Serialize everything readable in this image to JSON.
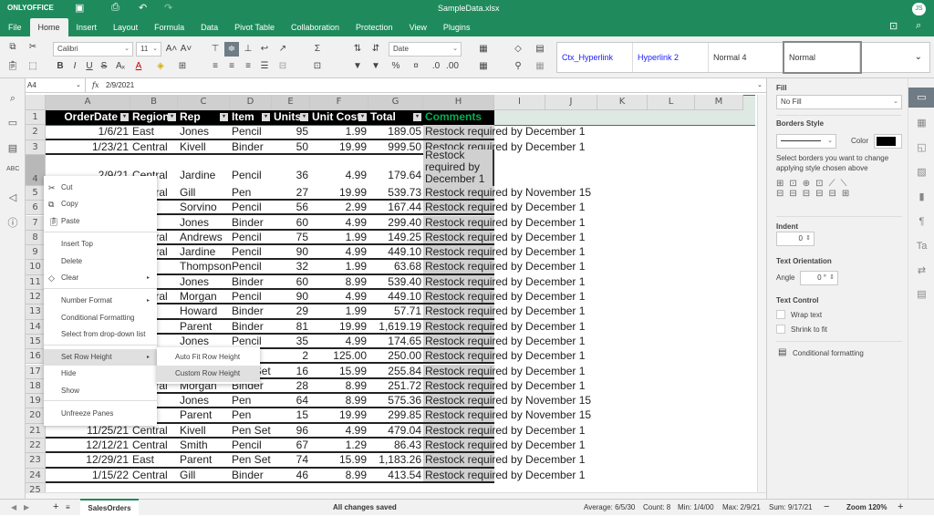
{
  "app": {
    "brand": "ONLYOFFICE",
    "file_title": "SampleData.xlsx",
    "user_initials": "JS"
  },
  "menu_tabs": [
    "File",
    "Home",
    "Insert",
    "Layout",
    "Formula",
    "Data",
    "Pivot Table",
    "Collaboration",
    "Protection",
    "View",
    "Plugins"
  ],
  "toolbar": {
    "font_name": "Calibri",
    "font_size": "11",
    "number_format": "Date",
    "styles": [
      "Ctx_Hyperlink",
      "Hyperlink 2",
      "Normal 4",
      "Normal"
    ]
  },
  "formula_bar": {
    "cell_ref": "A4",
    "fx": "fx",
    "value": "2/9/2021"
  },
  "columns": [
    "A",
    "B",
    "C",
    "D",
    "E",
    "F",
    "G",
    "H",
    "I",
    "J",
    "K",
    "L",
    "M"
  ],
  "header_row": [
    "OrderDate",
    "Region",
    "Rep",
    "Item",
    "Units",
    "Unit Cost",
    "Total",
    "Comments"
  ],
  "rows": [
    {
      "n": "2",
      "c": [
        "1/6/21",
        "East",
        "Jones",
        "Pencil",
        "95",
        "1.99",
        "189.05",
        "Restock required by December 1"
      ]
    },
    {
      "n": "3",
      "c": [
        "1/23/21",
        "Central",
        "Kivell",
        "Binder",
        "50",
        "19.99",
        "999.50",
        "Restock required by December 1"
      ]
    },
    {
      "n": "4",
      "c": [
        "2/9/21",
        "Central",
        "Jardine",
        "Pencil",
        "36",
        "4.99",
        "179.64",
        "Restock required by December 1"
      ]
    },
    {
      "n": "5",
      "c": [
        "",
        "Central",
        "Gill",
        "Pen",
        "27",
        "19.99",
        "539.73",
        "Restock required by November 15"
      ]
    },
    {
      "n": "6",
      "c": [
        "",
        "",
        "Sorvino",
        "Pencil",
        "56",
        "2.99",
        "167.44",
        "Restock required by December 1"
      ]
    },
    {
      "n": "7",
      "c": [
        "",
        "",
        "Jones",
        "Binder",
        "60",
        "4.99",
        "299.40",
        "Restock required by December 1"
      ]
    },
    {
      "n": "8",
      "c": [
        "",
        "Central",
        "Andrews",
        "Pencil",
        "75",
        "1.99",
        "149.25",
        "Restock required by December 1"
      ]
    },
    {
      "n": "9",
      "c": [
        "",
        "Central",
        "Jardine",
        "Pencil",
        "90",
        "4.99",
        "449.10",
        "Restock required by December 1"
      ]
    },
    {
      "n": "10",
      "c": [
        "",
        "",
        "Thompson",
        "Pencil",
        "32",
        "1.99",
        "63.68",
        "Restock required by December 1"
      ]
    },
    {
      "n": "11",
      "c": [
        "",
        "",
        "Jones",
        "Binder",
        "60",
        "8.99",
        "539.40",
        "Restock required by December 1"
      ]
    },
    {
      "n": "12",
      "c": [
        "",
        "Central",
        "Morgan",
        "Pencil",
        "90",
        "4.99",
        "449.10",
        "Restock required by December 1"
      ]
    },
    {
      "n": "13",
      "c": [
        "",
        "",
        "Howard",
        "Binder",
        "29",
        "1.99",
        "57.71",
        "Restock required by December 1"
      ]
    },
    {
      "n": "14",
      "c": [
        "",
        "",
        "Parent",
        "Binder",
        "81",
        "19.99",
        "1,619.19",
        "Restock required by December 1"
      ]
    },
    {
      "n": "15",
      "c": [
        "",
        "",
        "Jones",
        "Pencil",
        "35",
        "4.99",
        "174.65",
        "Restock required by December 1"
      ]
    },
    {
      "n": "16",
      "c": [
        "",
        "",
        "",
        "",
        "2",
        "125.00",
        "250.00",
        "Restock required by December 1"
      ]
    },
    {
      "n": "17",
      "c": [
        "",
        "",
        "",
        "Pen Set",
        "16",
        "15.99",
        "255.84",
        "Restock required by December 1"
      ]
    },
    {
      "n": "18",
      "c": [
        "",
        "Central",
        "Morgan",
        "Binder",
        "28",
        "8.99",
        "251.72",
        "Restock required by December 1"
      ]
    },
    {
      "n": "19",
      "c": [
        "",
        "",
        "Jones",
        "Pen",
        "64",
        "8.99",
        "575.36",
        "Restock required by November 15"
      ]
    },
    {
      "n": "20",
      "c": [
        "",
        "",
        "Parent",
        "Pen",
        "15",
        "19.99",
        "299.85",
        "Restock required by November 15"
      ]
    },
    {
      "n": "21",
      "c": [
        "11/25/21",
        "Central",
        "Kivell",
        "Pen Set",
        "96",
        "4.99",
        "479.04",
        "Restock required by December 1"
      ]
    },
    {
      "n": "22",
      "c": [
        "12/12/21",
        "Central",
        "Smith",
        "Pencil",
        "67",
        "1.29",
        "86.43",
        "Restock required by December 1"
      ]
    },
    {
      "n": "23",
      "c": [
        "12/29/21",
        "East",
        "Parent",
        "Pen Set",
        "74",
        "15.99",
        "1,183.26",
        "Restock required by December 1"
      ]
    },
    {
      "n": "24",
      "c": [
        "1/15/22",
        "Central",
        "Gill",
        "Binder",
        "46",
        "8.99",
        "413.54",
        "Restock required by December 1"
      ]
    }
  ],
  "context_menu": {
    "items": [
      {
        "label": "Cut",
        "icon": "scissors"
      },
      {
        "label": "Copy",
        "icon": "copy"
      },
      {
        "label": "Paste",
        "icon": "paste"
      },
      {
        "label": "Insert Top"
      },
      {
        "label": "Delete"
      },
      {
        "label": "Clear",
        "icon": "eraser",
        "submenu": true
      },
      {
        "label": "Number Format",
        "submenu": true
      },
      {
        "label": "Conditional Formatting"
      },
      {
        "label": "Select from drop-down list"
      },
      {
        "label": "Set Row Height",
        "submenu": true
      },
      {
        "label": "Hide"
      },
      {
        "label": "Show"
      },
      {
        "label": "Unfreeze Panes"
      }
    ],
    "submenu": [
      "Auto Fit Row Height",
      "Custom Row Height"
    ]
  },
  "right_panel": {
    "fill_label": "Fill",
    "fill_value": "No Fill",
    "borders_style": "Borders Style",
    "color_label": "Color",
    "border_color": "#000000",
    "borders_hint": "Select borders you want to change applying style chosen above",
    "indent_label": "Indent",
    "indent_value": "0",
    "orientation_label": "Text Orientation",
    "angle_label": "Angle",
    "angle_value": "0 °",
    "text_control": "Text Control",
    "wrap_text": "Wrap text",
    "shrink": "Shrink to fit",
    "cond_fmt": "Conditional formatting"
  },
  "sheet_tab": "SalesOrders",
  "status": {
    "saved": "All changes saved",
    "average": "Average: 6/5/30",
    "count": "Count: 8",
    "min": "Min: 1/4/00",
    "max": "Max: 2/9/21",
    "sum": "Sum: 9/17/21",
    "zoom": "Zoom 120%"
  },
  "colors": {
    "brand": "#1f8b5c",
    "comments_header": "#00b050"
  }
}
